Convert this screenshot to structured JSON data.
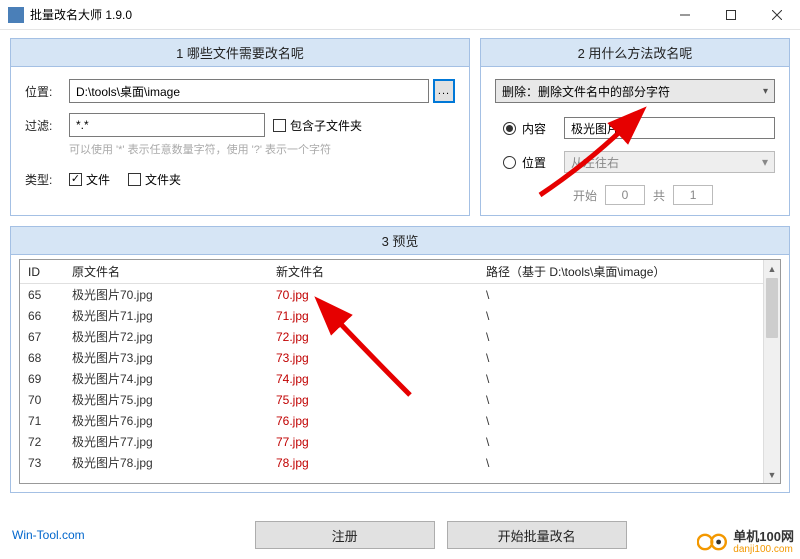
{
  "window": {
    "title": "批量改名大师 1.9.0"
  },
  "panel1": {
    "header": "1 哪些文件需要改名呢",
    "location_label": "位置:",
    "location_value": "D:\\tools\\桌面\\image",
    "browse_label": "...",
    "filter_label": "过滤:",
    "filter_value": "*.*",
    "subfolder_label": "包含子文件夹",
    "hint": "可以使用 '*' 表示任意数量字符，使用 '?' 表示一个字符",
    "type_label": "类型:",
    "cb_file": "文件",
    "cb_folder": "文件夹"
  },
  "panel2": {
    "header": "2 用什么方法改名呢",
    "method": "删除：删除文件名中的部分字符",
    "radio_content": "内容",
    "radio_position": "位置",
    "content_value": "极光图片",
    "direction": "从左往右",
    "start_label": "开始",
    "start_value": "0",
    "count_label": "共",
    "count_value": "1"
  },
  "panel3": {
    "header": "3 预览",
    "columns": {
      "id": "ID",
      "old": "原文件名",
      "new": "新文件名",
      "path": "路径（基于 D:\\tools\\桌面\\image）"
    },
    "rows": [
      {
        "id": "65",
        "old": "极光图片70.jpg",
        "new": "70.jpg",
        "path": "\\"
      },
      {
        "id": "66",
        "old": "极光图片71.jpg",
        "new": "71.jpg",
        "path": "\\"
      },
      {
        "id": "67",
        "old": "极光图片72.jpg",
        "new": "72.jpg",
        "path": "\\"
      },
      {
        "id": "68",
        "old": "极光图片73.jpg",
        "new": "73.jpg",
        "path": "\\"
      },
      {
        "id": "69",
        "old": "极光图片74.jpg",
        "new": "74.jpg",
        "path": "\\"
      },
      {
        "id": "70",
        "old": "极光图片75.jpg",
        "new": "75.jpg",
        "path": "\\"
      },
      {
        "id": "71",
        "old": "极光图片76.jpg",
        "new": "76.jpg",
        "path": "\\"
      },
      {
        "id": "72",
        "old": "极光图片77.jpg",
        "new": "77.jpg",
        "path": "\\"
      },
      {
        "id": "73",
        "old": "极光图片78.jpg",
        "new": "78.jpg",
        "path": "\\"
      }
    ]
  },
  "footer": {
    "link": "Win-Tool.com",
    "register": "注册",
    "start": "开始批量改名"
  },
  "watermark": {
    "line1": "单机100网",
    "line2": "danji100.com"
  }
}
